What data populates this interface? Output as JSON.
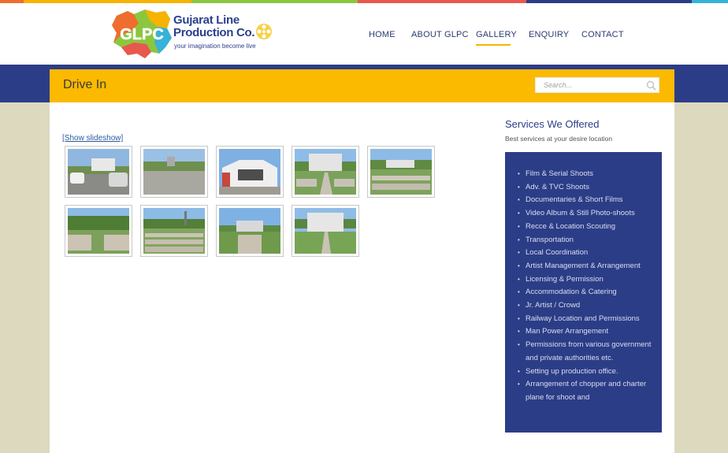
{
  "colors": {
    "strip": [
      "#ef6d2f",
      "#f6b300",
      "#8cc63f",
      "#e8584e",
      "#2c3d87",
      "#37b2d8"
    ],
    "accent": "#fbb900",
    "navy": "#2c3d87",
    "page_bg": "#dcd9be"
  },
  "logo": {
    "mark_text": "GLPC",
    "title_line1": "Gujarat Line",
    "title_line2": "Production Co.",
    "tagline": "your imagination become live"
  },
  "nav": {
    "items": [
      {
        "label": "HOME",
        "active": false
      },
      {
        "label": "ABOUT GLPC",
        "active": false
      },
      {
        "label": "GALLERY",
        "active": true
      },
      {
        "label": "ENQUIRY",
        "active": false
      },
      {
        "label": "CONTACT",
        "active": false
      }
    ]
  },
  "page": {
    "title": "Drive In",
    "search_placeholder": "Search..."
  },
  "gallery": {
    "slideshow_link": "[Show slideshow]",
    "thumbnails": [
      {
        "subject": "parking lot with cars and screen"
      },
      {
        "subject": "gravel ground with trees"
      },
      {
        "subject": "drive-in building"
      },
      {
        "subject": "screen with seating rows"
      },
      {
        "subject": "seating rows and screen"
      },
      {
        "subject": "seating blocks under trees"
      },
      {
        "subject": "seating rows with tower"
      },
      {
        "subject": "building with garden steps"
      },
      {
        "subject": "screen with lawn path"
      }
    ]
  },
  "sidebar": {
    "title": "Services We Offered",
    "subtitle": "Best services at your desire location",
    "services": [
      "Film & Serial Shoots",
      "Adv. & TVC Shoots",
      "Documentaries & Short Films",
      "Video Album & Still Photo-shoots",
      "Recce & Location Scouting",
      "Transportation",
      "Local Coordination",
      "Artist Management & Arrangement",
      "Licensing & Permission",
      "Accommodation & Catering",
      "Jr. Artist / Crowd",
      "Railway Location and Permissions",
      "Man Power Arrangement",
      "Permissions from various government and private authorities etc.",
      "Setting up production office.",
      "Arrangement of chopper and charter plane for shoot and"
    ]
  }
}
